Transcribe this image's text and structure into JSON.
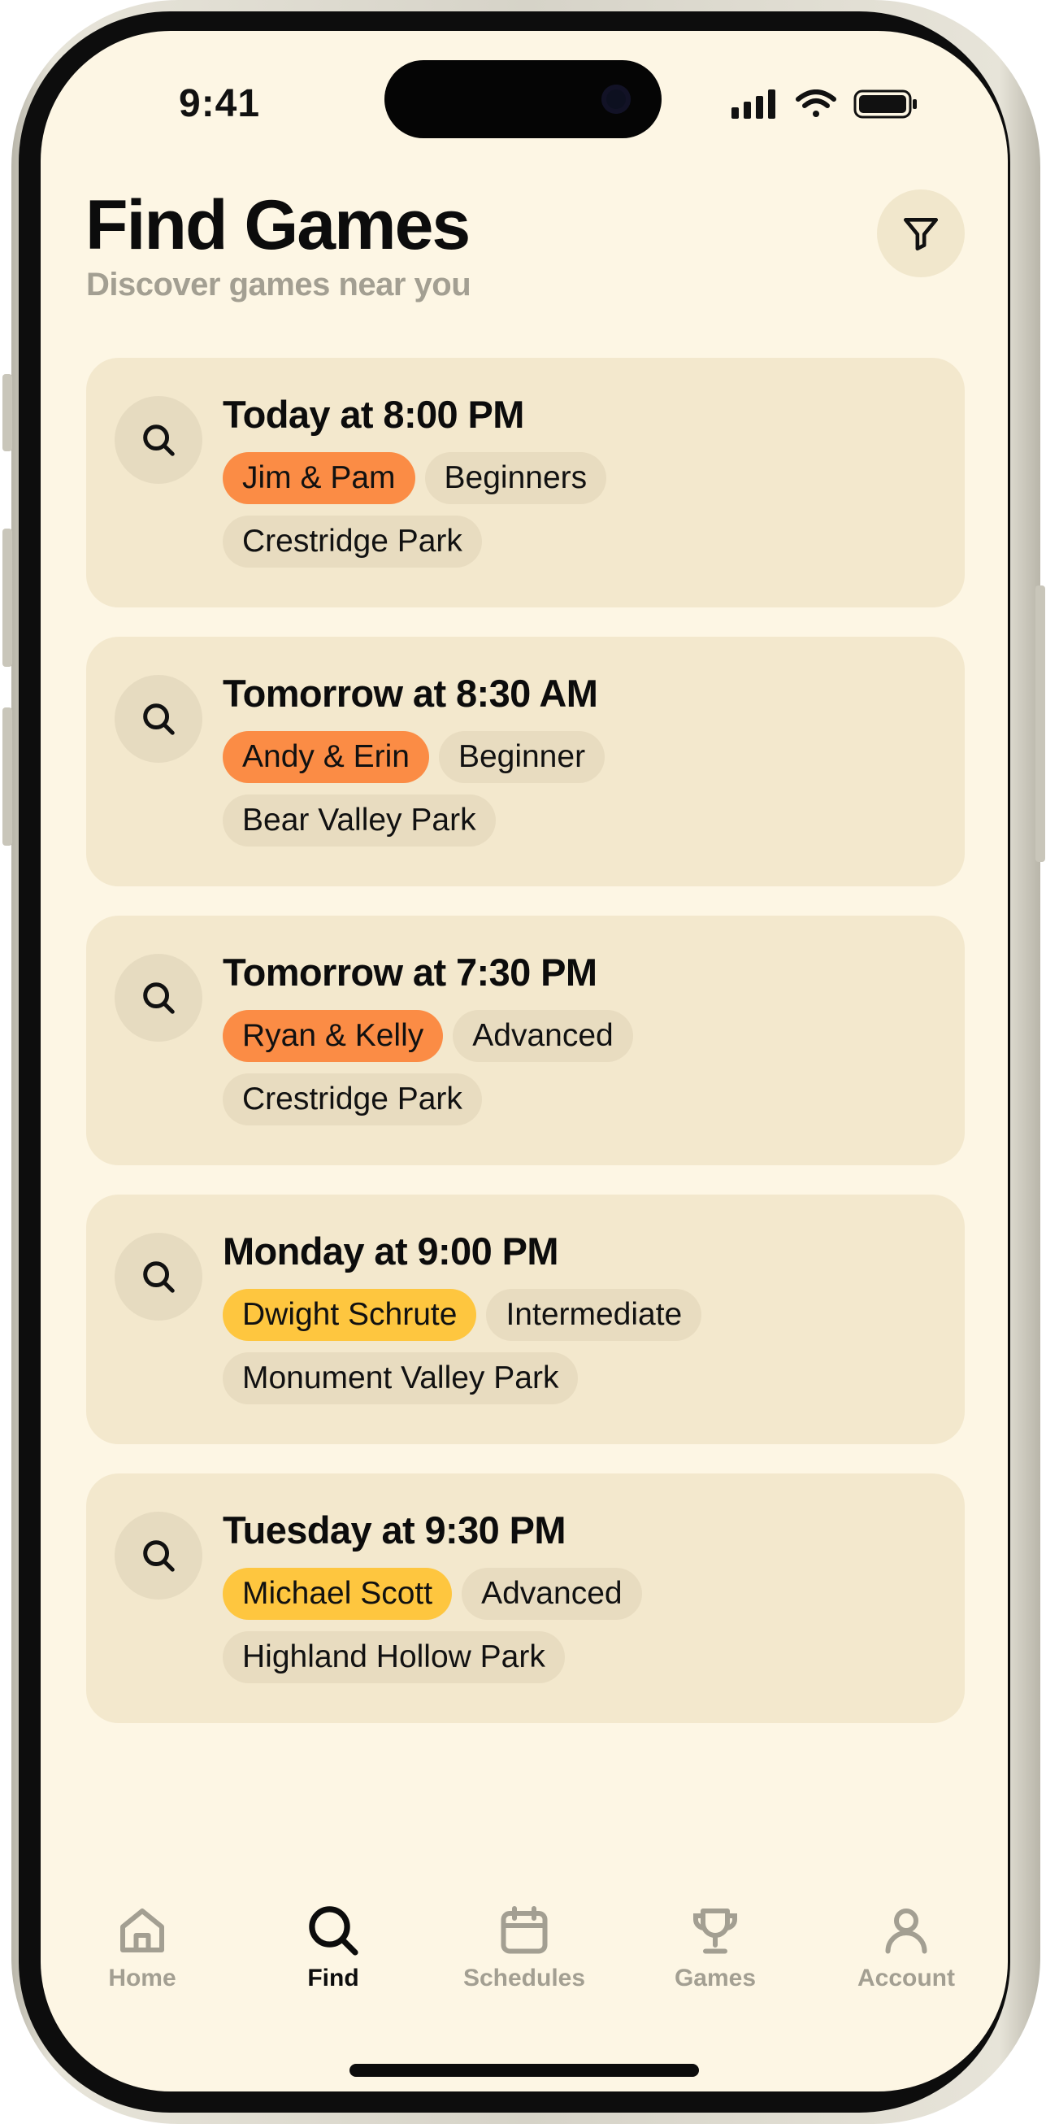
{
  "status_bar": {
    "time": "9:41"
  },
  "header": {
    "title": "Find Games",
    "subtitle": "Discover games near you",
    "filter_icon": "filter-icon"
  },
  "games": [
    {
      "when": "Today at 8:00 PM",
      "host": "Jim & Pam",
      "host_color": "#fb8c45",
      "level": "Beginners",
      "location": "Crestridge Park"
    },
    {
      "when": "Tomorrow at 8:30 AM",
      "host": "Andy & Erin",
      "host_color": "#fb8c45",
      "level": "Beginner",
      "location": "Bear Valley Park"
    },
    {
      "when": "Tomorrow at 7:30 PM",
      "host": "Ryan & Kelly",
      "host_color": "#fb8c45",
      "level": "Advanced",
      "location": "Crestridge Park"
    },
    {
      "when": "Monday at 9:00 PM",
      "host": "Dwight Schrute",
      "host_color": "#fec63f",
      "level": "Intermediate",
      "location": "Monument Valley Park"
    },
    {
      "when": "Tuesday at 9:30 PM",
      "host": "Michael Scott",
      "host_color": "#fec63f",
      "level": "Advanced",
      "location": "Highland Hollow Park"
    }
  ],
  "tab_bar": {
    "items": [
      {
        "label": "Home",
        "icon": "home-icon",
        "active": false
      },
      {
        "label": "Find",
        "icon": "search-icon",
        "active": true
      },
      {
        "label": "Schedules",
        "icon": "calendar-icon",
        "active": false
      },
      {
        "label": "Games",
        "icon": "trophy-icon",
        "active": false
      },
      {
        "label": "Account",
        "icon": "person-icon",
        "active": false
      }
    ]
  },
  "colors": {
    "background": "#fdf6e4",
    "card": "#f3e8cd",
    "chip": "#e8dcc0",
    "accent_orange": "#fb8c45",
    "accent_yellow": "#fec63f",
    "muted_text": "#a39f92"
  }
}
